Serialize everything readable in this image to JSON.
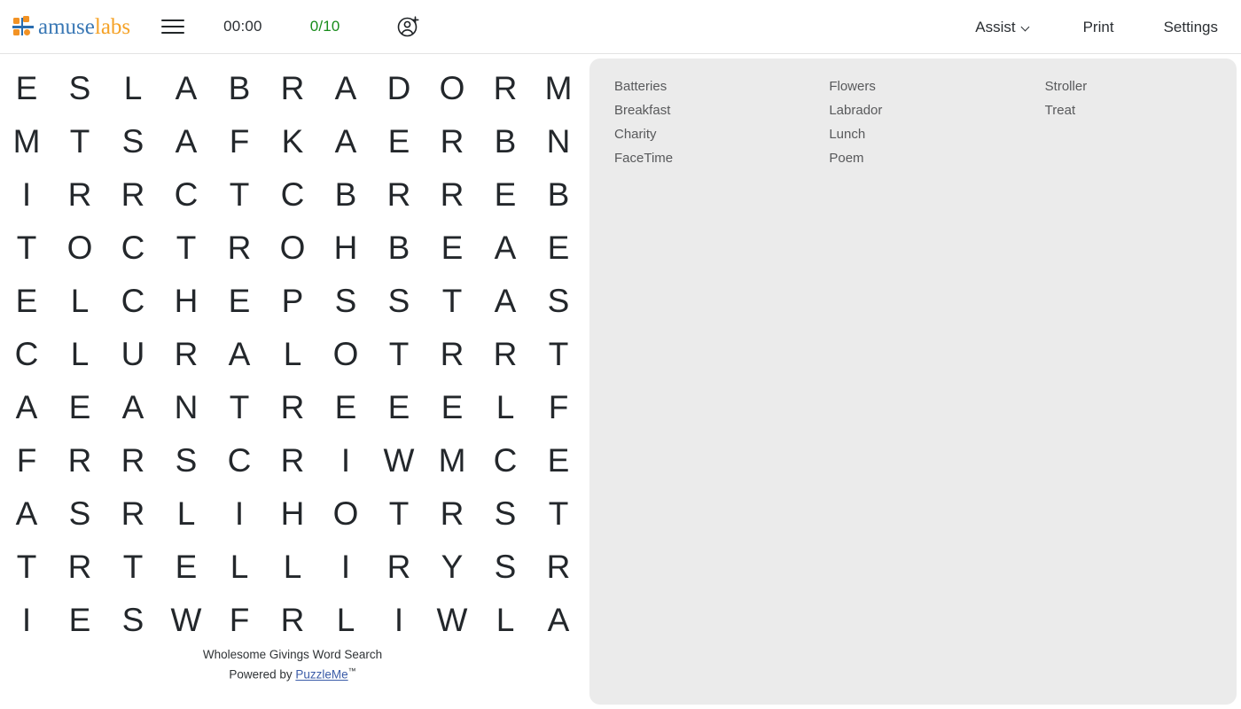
{
  "header": {
    "brand": {
      "amuse": "amuse",
      "labs": "labs",
      "icon": "amuselabs-logo-mark"
    },
    "menu_icon": "hamburger-menu-icon",
    "timer": "00:00",
    "score": "0/10",
    "score_color": "#188c1b",
    "avatar_icon": "add-person-icon",
    "assist_label": "Assist",
    "assist_caret": "chevron-down-icon",
    "print_label": "Print",
    "settings_label": "Settings"
  },
  "puzzle": {
    "rows": 11,
    "cols": 11,
    "grid": [
      [
        "E",
        "S",
        "L",
        "A",
        "B",
        "R",
        "A",
        "D",
        "O",
        "R",
        "M"
      ],
      [
        "M",
        "T",
        "S",
        "A",
        "F",
        "K",
        "A",
        "E",
        "R",
        "B",
        "N"
      ],
      [
        "I",
        "R",
        "R",
        "C",
        "T",
        "C",
        "B",
        "R",
        "R",
        "E",
        "B"
      ],
      [
        "T",
        "O",
        "C",
        "T",
        "R",
        "O",
        "H",
        "B",
        "E",
        "A",
        "E"
      ],
      [
        "E",
        "L",
        "C",
        "H",
        "E",
        "P",
        "S",
        "S",
        "T",
        "A",
        "S"
      ],
      [
        "C",
        "L",
        "U",
        "R",
        "A",
        "L",
        "O",
        "T",
        "R",
        "R",
        "T"
      ],
      [
        "A",
        "E",
        "A",
        "N",
        "T",
        "R",
        "E",
        "E",
        "E",
        "L",
        "F"
      ],
      [
        "F",
        "R",
        "R",
        "S",
        "C",
        "R",
        "I",
        "W",
        "M",
        "C",
        "E"
      ],
      [
        "A",
        "S",
        "R",
        "L",
        "I",
        "H",
        "O",
        "T",
        "R",
        "S",
        "T"
      ],
      [
        "T",
        "R",
        "T",
        "E",
        "L",
        "L",
        "I",
        "R",
        "Y",
        "S",
        "R"
      ],
      [
        "I",
        "E",
        "S",
        "W",
        "F",
        "R",
        "L",
        "I",
        "W",
        "L",
        "A"
      ]
    ],
    "title": "Wholesome Givings Word Search",
    "powered_by_prefix": "Powered by ",
    "powered_by_link": "PuzzleMe",
    "trademark": "™"
  },
  "word_list": {
    "columns": [
      [
        "Batteries",
        "Breakfast",
        "Charity",
        "FaceTime"
      ],
      [
        "Flowers",
        "Labrador",
        "Lunch",
        "Poem"
      ],
      [
        "Stroller",
        "Treat"
      ]
    ]
  },
  "colors": {
    "panel_bg": "#ebebeb",
    "page_bg": "#ffffff",
    "letter": "#23272b",
    "word_text": "#58595b",
    "brand_blue": "#3a78b5",
    "brand_orange": "#f5a227",
    "link_blue": "#3b5ca8"
  }
}
